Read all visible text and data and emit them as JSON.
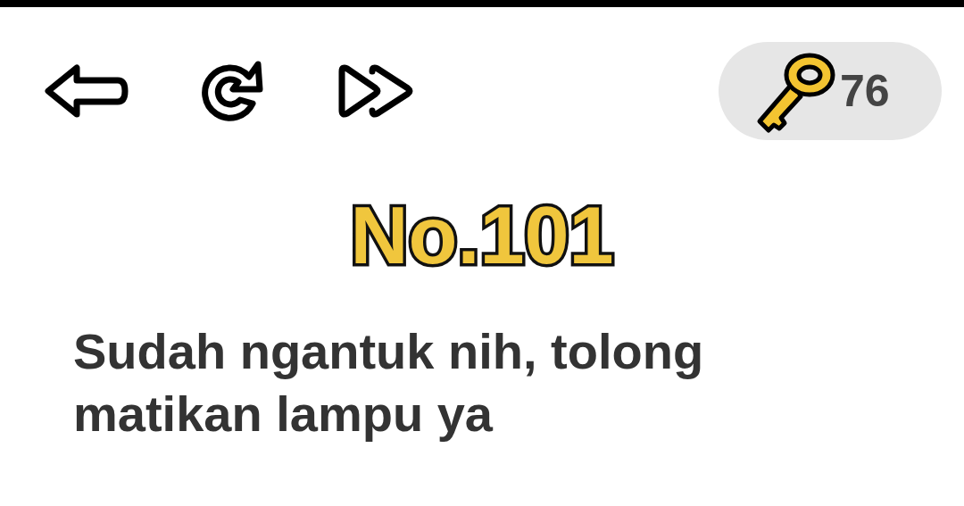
{
  "toolbar": {
    "buttons": [
      {
        "kind": "back"
      },
      {
        "kind": "restart"
      },
      {
        "kind": "skip"
      }
    ]
  },
  "keys": {
    "count": "76"
  },
  "level": {
    "title": "No.101"
  },
  "question": "Sudah ngantuk nih, tolong matikan lampu ya"
}
